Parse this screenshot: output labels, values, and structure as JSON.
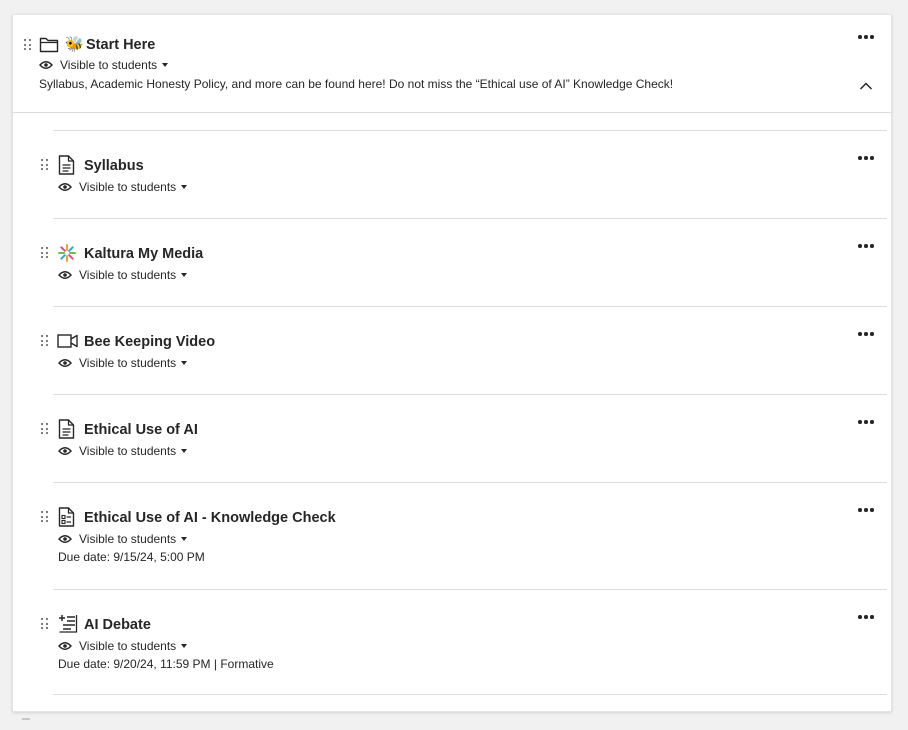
{
  "folder": {
    "emoji": "🐝",
    "title": "Start Here",
    "visibility": "Visible to students",
    "description": "Syllabus, Academic Honesty Policy, and more can be found here! Do not miss the “Ethical use of AI” Knowledge Check!"
  },
  "items": [
    {
      "title": "Syllabus",
      "icon": "document-icon",
      "visibility": "Visible to students"
    },
    {
      "title": "Kaltura My Media",
      "icon": "kaltura-icon",
      "visibility": "Visible to students"
    },
    {
      "title": "Bee Keeping Video",
      "icon": "video-camera-icon",
      "visibility": "Visible to students"
    },
    {
      "title": "Ethical Use of AI",
      "icon": "document-icon",
      "visibility": "Visible to students"
    },
    {
      "title": "Ethical Use of AI - Knowledge Check",
      "icon": "test-icon",
      "visibility": "Visible to students",
      "due": "Due date: 9/15/24, 5:00 PM"
    },
    {
      "title": "AI Debate",
      "icon": "discussion-icon",
      "visibility": "Visible to students",
      "due": "Due date: 9/20/24, 11:59 PM | Formative"
    }
  ]
}
